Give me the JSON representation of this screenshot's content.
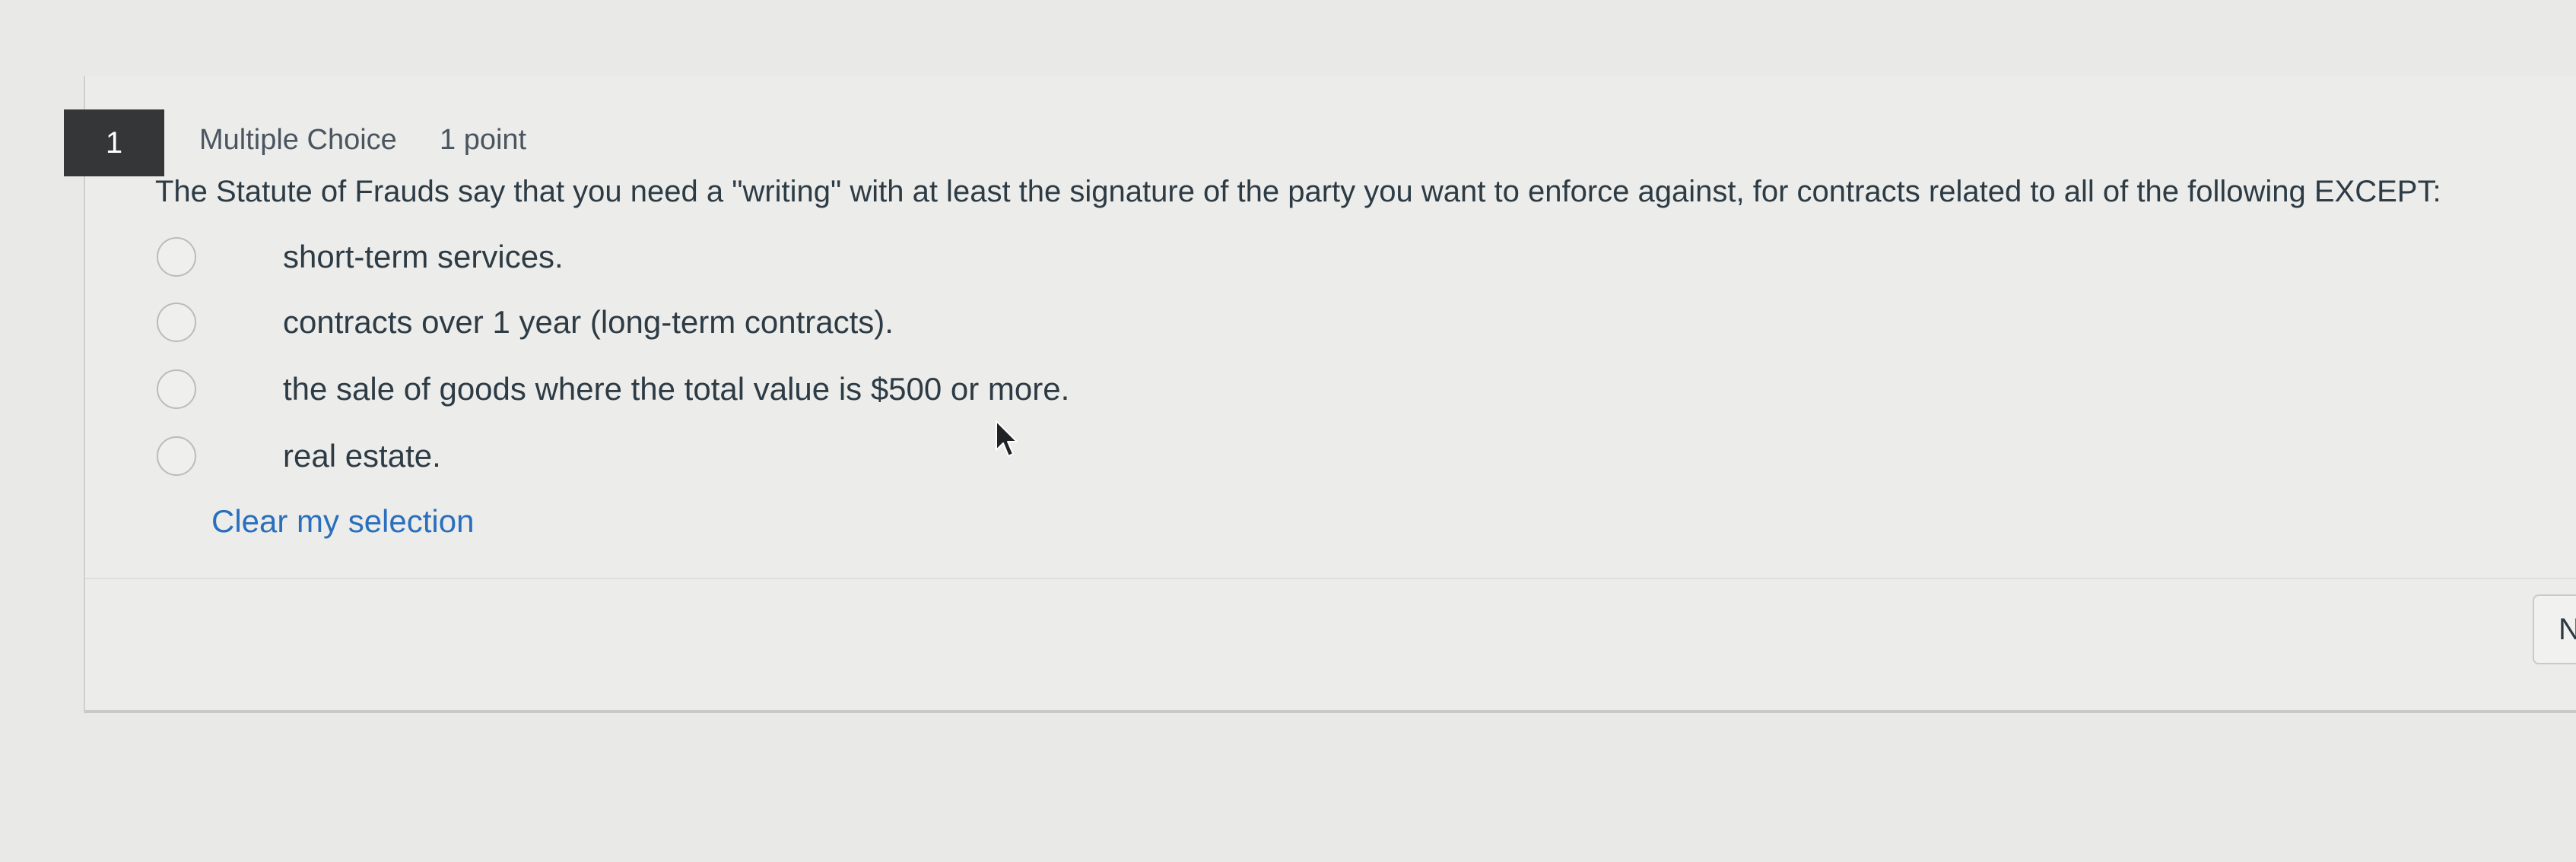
{
  "question": {
    "number": "1",
    "type": "Multiple Choice",
    "points": "1 point",
    "text": "The Statute of Frauds say that you need a \"writing\" with at least the signature of the party you want to enforce against, for contracts related to all of the following EXCEPT:"
  },
  "options": [
    {
      "label": "short-term services.",
      "selected": false
    },
    {
      "label": "contracts over 1 year (long-term contracts).",
      "selected": false
    },
    {
      "label": "the sale of goods where the total value is $500 or more.",
      "selected": false
    },
    {
      "label": "real estate.",
      "selected": false
    }
  ],
  "clear_label": "Clear my selection",
  "next_button_label": "N",
  "icons": {
    "cursor": "mouse-pointer-icon"
  },
  "colors": {
    "link": "#2a6fbd",
    "number_badge": "#343637",
    "text": "#2d3b45"
  }
}
